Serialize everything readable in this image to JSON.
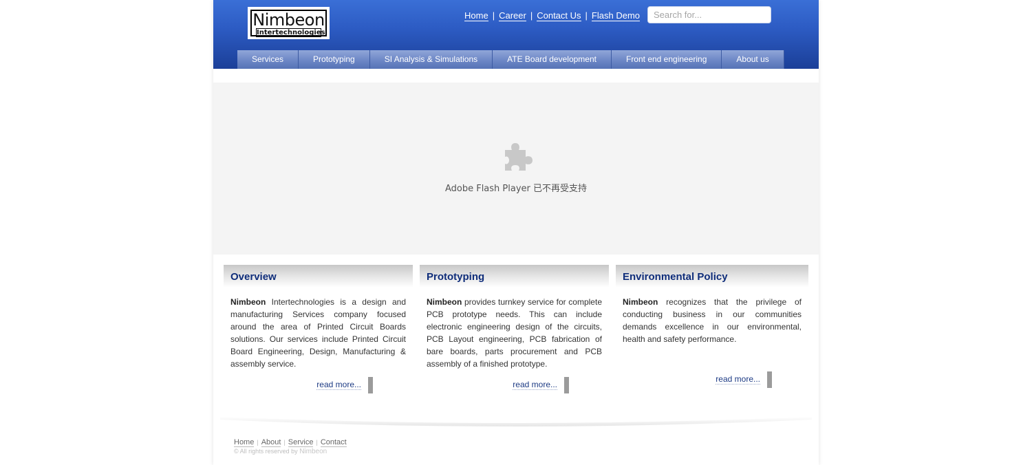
{
  "header": {
    "logo": {
      "title": "Nimbeon",
      "subtitle": "Intertechnologies"
    },
    "toplinks": [
      "Home",
      "Career",
      "Contact Us",
      "Flash Demo"
    ],
    "separator": "|",
    "search_placeholder": "Search for..."
  },
  "nav": [
    "Services",
    "Prototyping",
    "SI Analysis & Simulations",
    "ATE Board development",
    "Front end engineering",
    "About us"
  ],
  "flash": {
    "icon": "puzzle-plugin-icon",
    "message": "Adobe Flash Player 已不再受支持"
  },
  "columns": [
    {
      "title": "Overview",
      "bold": "Nimbeon",
      "text": " Intertechnologies is a design and manufacturing Services company focused around the area of Printed Circuit Boards solutions. Our services include Printed Circuit Board Engineering, Design, Manufacturing & assembly service.",
      "readmore": "read more..."
    },
    {
      "title": "Prototyping",
      "bold": "Nimbeon",
      "text": " provides turnkey service for complete PCB prototype needs. This can include electronic engineering design of the circuits, PCB Layout engineering, PCB fabrication of bare boards, parts procurement and PCB assembly of a finished prototype.",
      "readmore": "read more..."
    },
    {
      "title": "Environmental Policy",
      "bold": "Nimbeon",
      "text": " recognizes that the privilege of conducting business in our communities demands excellence in our environmental, health and safety performance.",
      "readmore": "read more..."
    }
  ],
  "footer": {
    "links": [
      "Home",
      "About",
      "Service",
      "Contact"
    ],
    "link_separator": "|",
    "copyright_prefix": "© All rights reserved by",
    "copyright_brand": "Nimbeon"
  },
  "colors": {
    "header_blue": "#2d5cc4",
    "heading_navy": "#0f2d7a",
    "flash_bg": "#f4f4f4"
  }
}
